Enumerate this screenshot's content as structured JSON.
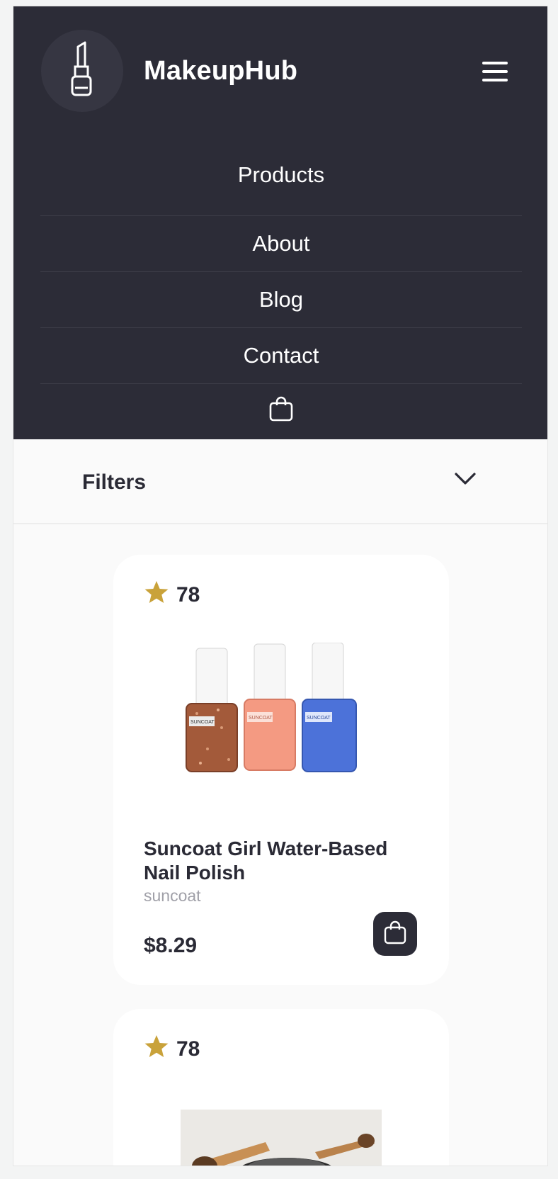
{
  "header": {
    "brand": "MakeupHub",
    "logo_icon": "lipstick-icon",
    "menu_icon": "hamburger-menu-icon"
  },
  "nav": {
    "items": [
      {
        "label": "Products"
      },
      {
        "label": "About"
      },
      {
        "label": "Blog"
      },
      {
        "label": "Contact"
      }
    ],
    "cart_icon": "shopping-bag-icon"
  },
  "filters": {
    "label": "Filters",
    "toggle_icon": "chevron-down-icon"
  },
  "products": [
    {
      "rating": "78",
      "name": "Suncoat Girl Water-Based Nail Polish",
      "brand": "suncoat",
      "price": "$8.29",
      "image_labels": [
        "SUNCOAT",
        "SUNCOAT",
        "SUNCOAT"
      ]
    },
    {
      "rating": "78"
    }
  ],
  "colors": {
    "nav_bg": "#2c2c37",
    "star": "#c9a23a",
    "text_dark": "#2a2a35",
    "text_muted": "#a0a0a8"
  }
}
